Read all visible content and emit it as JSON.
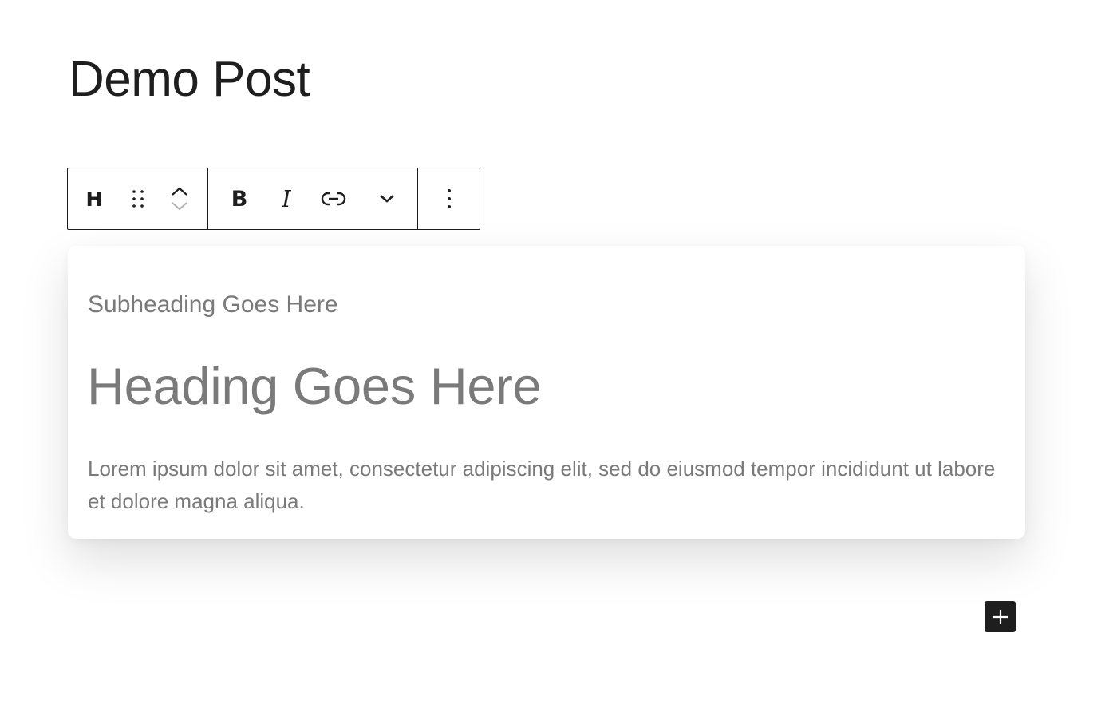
{
  "post": {
    "title": "Demo Post"
  },
  "toolbar": {
    "block_type_label": "H",
    "bold_label": "B",
    "italic_label": "I",
    "icons": {
      "drag": "drag-handle-icon",
      "move_up": "chevron-up-icon",
      "move_down": "chevron-down-icon",
      "link": "link-icon",
      "more_rich_text": "chevron-down-icon",
      "options": "more-vertical-icon"
    }
  },
  "card": {
    "subheading": "Subheading Goes Here",
    "heading": "Heading Goes Here",
    "body": "Lorem ipsum dolor sit amet, consectetur adipiscing elit, sed do eiusmod tempor incididunt ut labore et dolore magna aliqua."
  },
  "inserter": {
    "icon": "plus-icon"
  },
  "colors": {
    "text_dark": "#1e1e1e",
    "text_placeholder": "#7a7a7a",
    "background": "#ffffff"
  }
}
